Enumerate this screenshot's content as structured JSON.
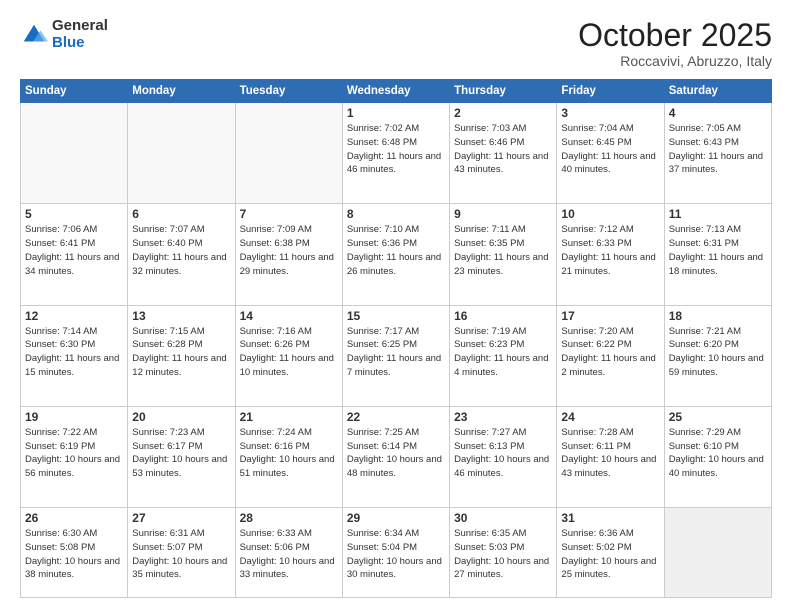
{
  "header": {
    "logo_general": "General",
    "logo_blue": "Blue",
    "month_title": "October 2025",
    "location": "Roccavivi, Abruzzo, Italy"
  },
  "weekdays": [
    "Sunday",
    "Monday",
    "Tuesday",
    "Wednesday",
    "Thursday",
    "Friday",
    "Saturday"
  ],
  "weeks": [
    [
      {
        "num": "",
        "info": "",
        "empty": true
      },
      {
        "num": "",
        "info": "",
        "empty": true
      },
      {
        "num": "",
        "info": "",
        "empty": true
      },
      {
        "num": "1",
        "info": "Sunrise: 7:02 AM\nSunset: 6:48 PM\nDaylight: 11 hours and 46 minutes.",
        "empty": false
      },
      {
        "num": "2",
        "info": "Sunrise: 7:03 AM\nSunset: 6:46 PM\nDaylight: 11 hours and 43 minutes.",
        "empty": false
      },
      {
        "num": "3",
        "info": "Sunrise: 7:04 AM\nSunset: 6:45 PM\nDaylight: 11 hours and 40 minutes.",
        "empty": false
      },
      {
        "num": "4",
        "info": "Sunrise: 7:05 AM\nSunset: 6:43 PM\nDaylight: 11 hours and 37 minutes.",
        "empty": false
      }
    ],
    [
      {
        "num": "5",
        "info": "Sunrise: 7:06 AM\nSunset: 6:41 PM\nDaylight: 11 hours and 34 minutes.",
        "empty": false
      },
      {
        "num": "6",
        "info": "Sunrise: 7:07 AM\nSunset: 6:40 PM\nDaylight: 11 hours and 32 minutes.",
        "empty": false
      },
      {
        "num": "7",
        "info": "Sunrise: 7:09 AM\nSunset: 6:38 PM\nDaylight: 11 hours and 29 minutes.",
        "empty": false
      },
      {
        "num": "8",
        "info": "Sunrise: 7:10 AM\nSunset: 6:36 PM\nDaylight: 11 hours and 26 minutes.",
        "empty": false
      },
      {
        "num": "9",
        "info": "Sunrise: 7:11 AM\nSunset: 6:35 PM\nDaylight: 11 hours and 23 minutes.",
        "empty": false
      },
      {
        "num": "10",
        "info": "Sunrise: 7:12 AM\nSunset: 6:33 PM\nDaylight: 11 hours and 21 minutes.",
        "empty": false
      },
      {
        "num": "11",
        "info": "Sunrise: 7:13 AM\nSunset: 6:31 PM\nDaylight: 11 hours and 18 minutes.",
        "empty": false
      }
    ],
    [
      {
        "num": "12",
        "info": "Sunrise: 7:14 AM\nSunset: 6:30 PM\nDaylight: 11 hours and 15 minutes.",
        "empty": false
      },
      {
        "num": "13",
        "info": "Sunrise: 7:15 AM\nSunset: 6:28 PM\nDaylight: 11 hours and 12 minutes.",
        "empty": false
      },
      {
        "num": "14",
        "info": "Sunrise: 7:16 AM\nSunset: 6:26 PM\nDaylight: 11 hours and 10 minutes.",
        "empty": false
      },
      {
        "num": "15",
        "info": "Sunrise: 7:17 AM\nSunset: 6:25 PM\nDaylight: 11 hours and 7 minutes.",
        "empty": false
      },
      {
        "num": "16",
        "info": "Sunrise: 7:19 AM\nSunset: 6:23 PM\nDaylight: 11 hours and 4 minutes.",
        "empty": false
      },
      {
        "num": "17",
        "info": "Sunrise: 7:20 AM\nSunset: 6:22 PM\nDaylight: 11 hours and 2 minutes.",
        "empty": false
      },
      {
        "num": "18",
        "info": "Sunrise: 7:21 AM\nSunset: 6:20 PM\nDaylight: 10 hours and 59 minutes.",
        "empty": false
      }
    ],
    [
      {
        "num": "19",
        "info": "Sunrise: 7:22 AM\nSunset: 6:19 PM\nDaylight: 10 hours and 56 minutes.",
        "empty": false
      },
      {
        "num": "20",
        "info": "Sunrise: 7:23 AM\nSunset: 6:17 PM\nDaylight: 10 hours and 53 minutes.",
        "empty": false
      },
      {
        "num": "21",
        "info": "Sunrise: 7:24 AM\nSunset: 6:16 PM\nDaylight: 10 hours and 51 minutes.",
        "empty": false
      },
      {
        "num": "22",
        "info": "Sunrise: 7:25 AM\nSunset: 6:14 PM\nDaylight: 10 hours and 48 minutes.",
        "empty": false
      },
      {
        "num": "23",
        "info": "Sunrise: 7:27 AM\nSunset: 6:13 PM\nDaylight: 10 hours and 46 minutes.",
        "empty": false
      },
      {
        "num": "24",
        "info": "Sunrise: 7:28 AM\nSunset: 6:11 PM\nDaylight: 10 hours and 43 minutes.",
        "empty": false
      },
      {
        "num": "25",
        "info": "Sunrise: 7:29 AM\nSunset: 6:10 PM\nDaylight: 10 hours and 40 minutes.",
        "empty": false
      }
    ],
    [
      {
        "num": "26",
        "info": "Sunrise: 6:30 AM\nSunset: 5:08 PM\nDaylight: 10 hours and 38 minutes.",
        "empty": false
      },
      {
        "num": "27",
        "info": "Sunrise: 6:31 AM\nSunset: 5:07 PM\nDaylight: 10 hours and 35 minutes.",
        "empty": false
      },
      {
        "num": "28",
        "info": "Sunrise: 6:33 AM\nSunset: 5:06 PM\nDaylight: 10 hours and 33 minutes.",
        "empty": false
      },
      {
        "num": "29",
        "info": "Sunrise: 6:34 AM\nSunset: 5:04 PM\nDaylight: 10 hours and 30 minutes.",
        "empty": false
      },
      {
        "num": "30",
        "info": "Sunrise: 6:35 AM\nSunset: 5:03 PM\nDaylight: 10 hours and 27 minutes.",
        "empty": false
      },
      {
        "num": "31",
        "info": "Sunrise: 6:36 AM\nSunset: 5:02 PM\nDaylight: 10 hours and 25 minutes.",
        "empty": false
      },
      {
        "num": "",
        "info": "",
        "empty": true
      }
    ]
  ]
}
